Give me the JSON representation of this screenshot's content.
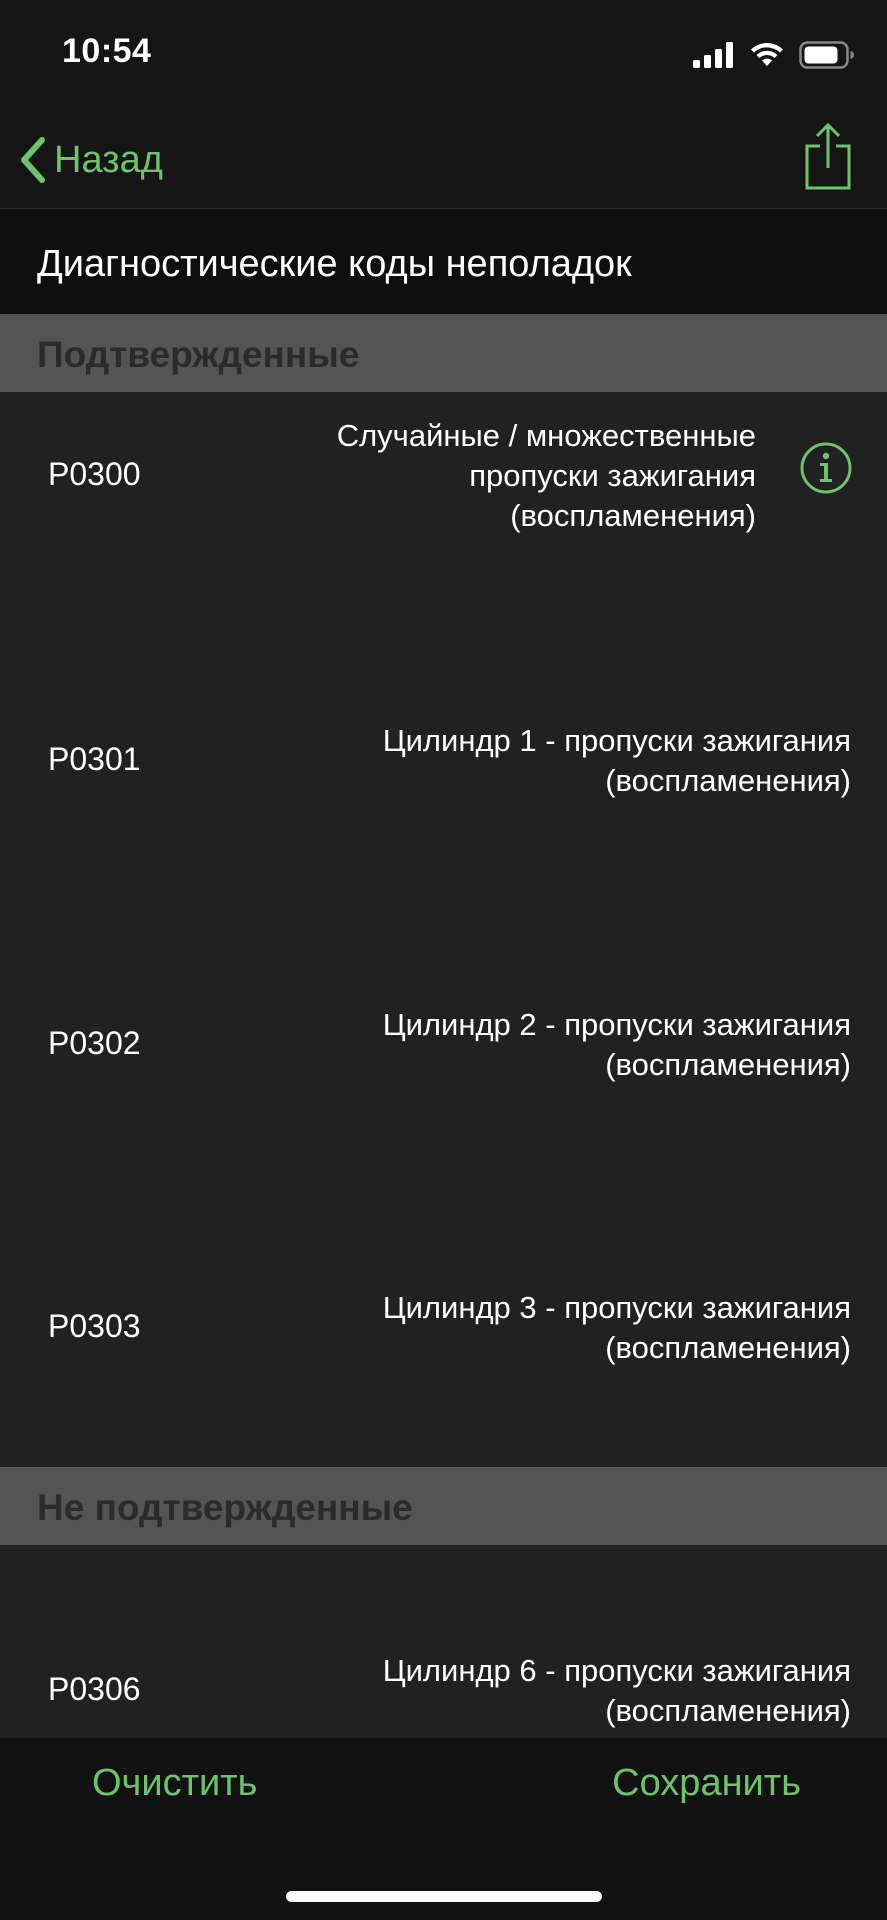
{
  "status_bar": {
    "time": "10:54",
    "icons": [
      "cellular-signal-icon",
      "wifi-icon",
      "battery-icon"
    ]
  },
  "nav": {
    "back_label": "Назад",
    "share_icon": "share-icon"
  },
  "page": {
    "title": "Диагностические коды неполадок"
  },
  "sections": [
    {
      "header": "Подтвержденные",
      "items": [
        {
          "code": "P0300",
          "description_lines": [
            "Случайные / множественные",
            "пропуски зажигания",
            "(воспламенения)"
          ],
          "has_info": true
        },
        {
          "code": "P0301",
          "description_lines": [
            "Цилиндр 1 - пропуски зажигания",
            "(воспламенения)"
          ],
          "has_info": false
        },
        {
          "code": "P0302",
          "description_lines": [
            "Цилиндр 2 - пропуски зажигания",
            "(воспламенения)"
          ],
          "has_info": false
        },
        {
          "code": "P0303",
          "description_lines": [
            "Цилиндр 3 - пропуски зажигания",
            "(воспламенения)"
          ],
          "has_info": false
        }
      ]
    },
    {
      "header": "Не подтвержденные",
      "items": [
        {
          "code": "P0306",
          "description_lines": [
            "Цилиндр 6 - пропуски зажигания",
            "(воспламенения)"
          ],
          "has_info": false
        }
      ]
    }
  ],
  "bottom_bar": {
    "clear_label": "Очистить",
    "save_label": "Сохранить"
  },
  "colors": {
    "accent": "#6cc46a",
    "background": "#212121",
    "section_header": "#545454",
    "title_bar": "#0f0f0f"
  }
}
